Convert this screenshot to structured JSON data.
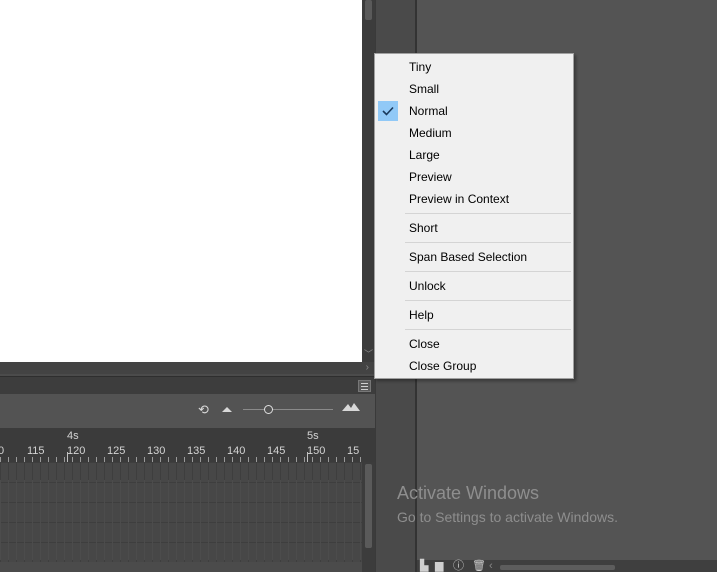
{
  "context_menu": {
    "items": [
      {
        "label": "Tiny",
        "checked": false
      },
      {
        "label": "Small",
        "checked": false
      },
      {
        "label": "Normal",
        "checked": true
      },
      {
        "label": "Medium",
        "checked": false
      },
      {
        "label": "Large",
        "checked": false
      },
      {
        "label": "Preview",
        "checked": false
      },
      {
        "label": "Preview in Context",
        "checked": false
      },
      {
        "label": "Short",
        "checked": false
      },
      {
        "label": "Span Based Selection",
        "checked": false
      },
      {
        "label": "Unlock",
        "checked": false
      },
      {
        "label": "Help",
        "checked": false
      },
      {
        "label": "Close",
        "checked": false
      },
      {
        "label": "Close Group",
        "checked": false
      }
    ]
  },
  "timeline": {
    "seconds": [
      "4s",
      "5s"
    ],
    "frame_numbers": [
      "0",
      "115",
      "120",
      "125",
      "130",
      "135",
      "140",
      "145",
      "150",
      "15"
    ],
    "icons": {
      "loop": "loop-icon",
      "zoom_out": "mountain-small-icon",
      "zoom_in": "mountain-large-icon",
      "panel_menu": "hamburger-menu-icon"
    }
  },
  "watermark": {
    "title": "Activate Windows",
    "subtitle": "Go to Settings to activate Windows."
  },
  "colors": {
    "menu_bg": "#f0f0f0",
    "check_highlight": "#91c9f7",
    "dark_panel": "#4b4b4b",
    "stage": "#ffffff"
  }
}
